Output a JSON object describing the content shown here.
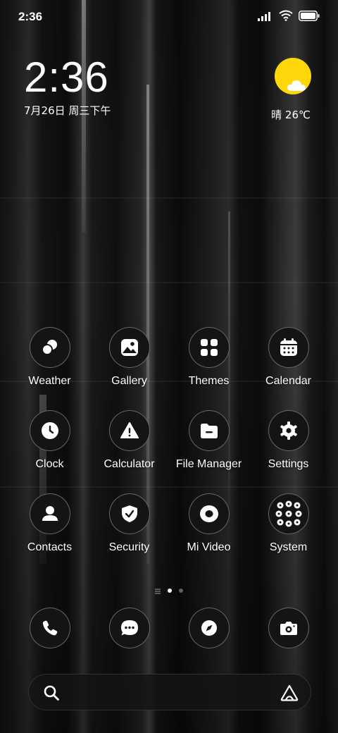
{
  "status_bar": {
    "time": "2:36",
    "signal_icon": "cellular-signal-icon",
    "wifi_icon": "wifi-icon",
    "battery_icon": "battery-icon"
  },
  "clock_widget": {
    "time": "2:36",
    "date": "7月26日 周三下午"
  },
  "weather_widget": {
    "icon": "sun-with-cloud-icon",
    "condition_temp": "晴 26℃",
    "accent_color": "#ffd60a"
  },
  "apps": [
    {
      "label": "Weather",
      "icon": "weather-icon"
    },
    {
      "label": "Gallery",
      "icon": "gallery-icon"
    },
    {
      "label": "Themes",
      "icon": "themes-icon"
    },
    {
      "label": "Calendar",
      "icon": "calendar-icon"
    },
    {
      "label": "Clock",
      "icon": "clock-icon"
    },
    {
      "label": "Calculator",
      "icon": "calculator-warning-icon"
    },
    {
      "label": "File Manager",
      "icon": "file-manager-icon"
    },
    {
      "label": "Settings",
      "icon": "gear-icon"
    },
    {
      "label": "Contacts",
      "icon": "contacts-icon"
    },
    {
      "label": "Security",
      "icon": "shield-check-icon"
    },
    {
      "label": "Mi Video",
      "icon": "video-icon"
    },
    {
      "label": "System",
      "icon": "folder-icon"
    }
  ],
  "page_indicator": {
    "pages": 2,
    "active_page": 1
  },
  "dock": [
    {
      "icon": "phone-icon"
    },
    {
      "icon": "messages-icon"
    },
    {
      "icon": "browser-compass-icon"
    },
    {
      "icon": "camera-icon"
    }
  ],
  "search_bar": {
    "search_icon": "search-icon",
    "assistant_icon": "assistant-icon"
  }
}
